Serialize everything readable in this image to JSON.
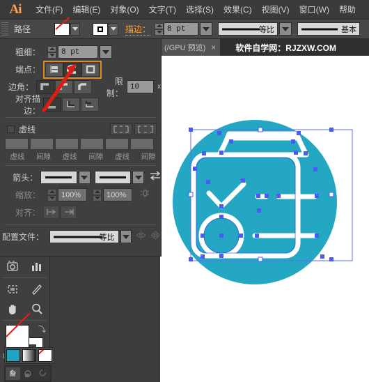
{
  "app": {
    "logo": "Ai"
  },
  "menubar": {
    "items": [
      {
        "label": "文件(F)"
      },
      {
        "label": "编辑(E)"
      },
      {
        "label": "对象(O)"
      },
      {
        "label": "文字(T)"
      },
      {
        "label": "选择(S)"
      },
      {
        "label": "效果(C)"
      },
      {
        "label": "视图(V)"
      },
      {
        "label": "窗口(W)"
      },
      {
        "label": "帮助"
      }
    ]
  },
  "options_bar": {
    "object_label": "路径",
    "fill_swatch": "none-swatch",
    "stroke_swatch": "stroke-square-swatch",
    "stroke_label": "描边：",
    "stroke_weight": "8 pt",
    "profile_1": "等比",
    "profile_2": "基本"
  },
  "document_tab": {
    "title": "(/GPU 预览)",
    "close": "×",
    "brand": "软件自学网：RJZXW.COM"
  },
  "stroke_panel": {
    "weight": {
      "label": "粗细：",
      "value": "8 pt"
    },
    "cap": {
      "label": "端点：",
      "buttons": [
        {
          "name": "butt-cap",
          "selected": false
        },
        {
          "name": "round-cap",
          "selected": true
        },
        {
          "name": "projecting-cap",
          "selected": false
        }
      ],
      "highlighted": true
    },
    "corner": {
      "label": "边角：",
      "buttons": [
        {
          "name": "miter-join",
          "selected": true
        },
        {
          "name": "round-join",
          "selected": false
        },
        {
          "name": "bevel-join",
          "selected": false
        }
      ],
      "limit_label": "限制：",
      "limit_value": "10",
      "limit_unit": "x"
    },
    "align": {
      "label": "对齐描边：",
      "buttons": [
        {
          "name": "align-center",
          "selected": true
        },
        {
          "name": "align-inside",
          "selected": false
        },
        {
          "name": "align-outside",
          "selected": false
        }
      ]
    },
    "dashed": {
      "label": "虚线",
      "checked": false,
      "end_buttons": [
        "dash-preserve",
        "dash-adjust"
      ],
      "fields": [
        "",
        "",
        "",
        "",
        "",
        ""
      ],
      "field_labels": [
        "虚线",
        "间隙",
        "虚线",
        "间隙",
        "虚线",
        "间隙"
      ]
    },
    "arrows": {
      "label": "箭头：",
      "start": "无",
      "end": "无",
      "swap_icon": "swap-arrows-icon"
    },
    "scale": {
      "label": "缩放：",
      "start_value": "100%",
      "end_value": "100%",
      "link_icon": "link-scale-icon"
    },
    "align_arrows": {
      "label": "对齐：",
      "buttons": [
        "extend-arrow",
        "align-arrow"
      ]
    },
    "profile": {
      "label": "配置文件：",
      "value": "等比",
      "flip_x_icon": "flip-horizontal-icon",
      "flip_y_icon": "flip-vertical-icon"
    }
  },
  "toolbar": {
    "tools": [
      {
        "name": "perspective-grid-tool"
      },
      {
        "name": "graph-tool"
      },
      {
        "name": "artboard-tool"
      },
      {
        "name": "slice-tool"
      },
      {
        "name": "hand-tool"
      },
      {
        "name": "zoom-tool"
      }
    ],
    "fill": "none",
    "stroke": "#ffffff",
    "color_modes": [
      {
        "name": "color-swatch",
        "color": "#1fa3bf"
      },
      {
        "name": "gradient-swatch",
        "color": "gradient"
      },
      {
        "name": "none-swatch",
        "color": "none"
      }
    ],
    "draw_modes": [
      {
        "name": "draw-normal",
        "selected": true
      },
      {
        "name": "draw-behind",
        "selected": false
      },
      {
        "name": "draw-inside",
        "selected": false
      }
    ]
  },
  "canvas": {
    "circle_color": "#24a7c2",
    "artwork": "clipboard-checklist-icon",
    "selection_color": "#4a5cf5",
    "artwork_stroke": "#ffffff"
  }
}
